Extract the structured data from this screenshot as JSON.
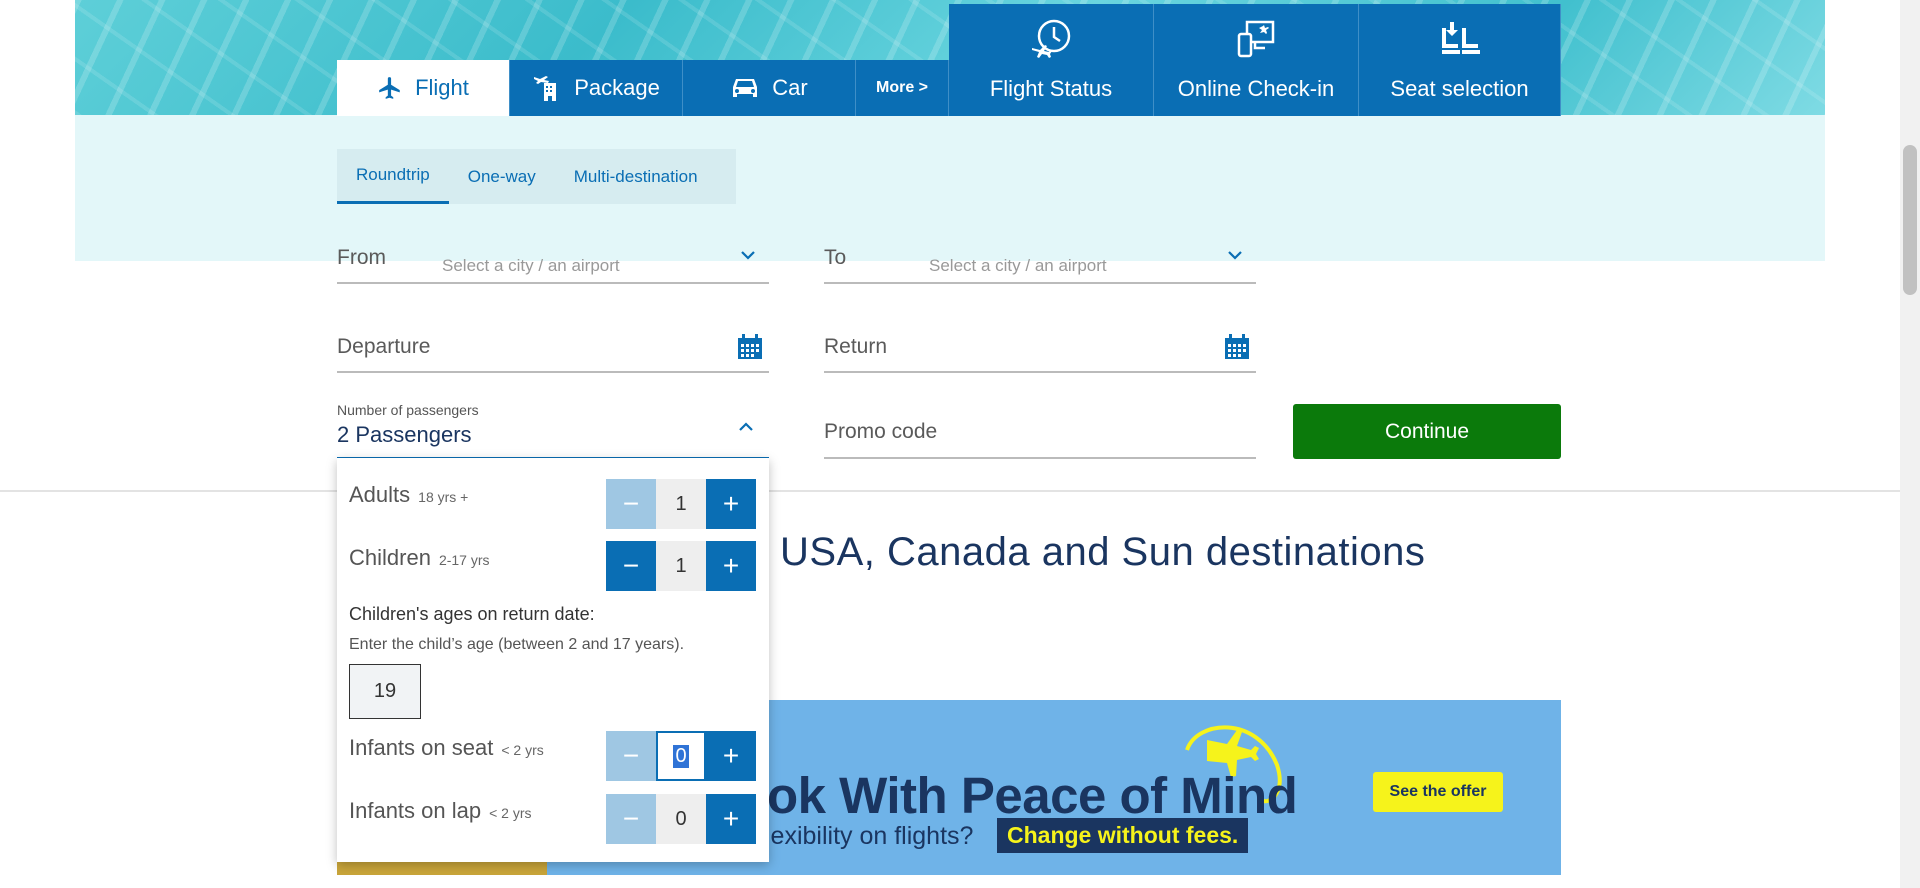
{
  "tabs": [
    {
      "label": "Flight",
      "icon": "plane-icon",
      "active": true
    },
    {
      "label": "Package",
      "icon": "hotel-plane-icon"
    },
    {
      "label": "Car",
      "icon": "car-icon"
    },
    {
      "label": "More >"
    }
  ],
  "tools": [
    {
      "label": "Flight Status",
      "icon": "clock-plane-icon"
    },
    {
      "label": "Online Check-in",
      "icon": "screen-phone-icon"
    },
    {
      "label": "Seat selection",
      "icon": "seats-icon"
    }
  ],
  "trip_types": [
    "Roundtrip",
    "One-way",
    "Multi-destination"
  ],
  "from": {
    "label": "From",
    "placeholder": "Select a city / an airport"
  },
  "to": {
    "label": "To",
    "placeholder": "Select a city / an airport"
  },
  "departure": {
    "label": "Departure"
  },
  "return": {
    "label": "Return"
  },
  "passengers": {
    "label": "Number of passengers",
    "value": "2 Passengers"
  },
  "promo": {
    "label": "Promo code"
  },
  "continue_label": "Continue",
  "pax": {
    "adults": {
      "label": "Adults",
      "range": "18 yrs +",
      "value": "1"
    },
    "children": {
      "label": "Children",
      "range": "2-17 yrs",
      "value": "1"
    },
    "ages_title": "Children's ages on return date:",
    "ages_hint": "Enter the child’s age (between 2 and 17 years).",
    "child_age": "19",
    "infants_seat": {
      "label": "Infants on seat",
      "range": "< 2 yrs",
      "value": "0"
    },
    "infants_lap": {
      "label": "Infants on lap",
      "range": "< 2 yrs",
      "value": "0"
    }
  },
  "promo_heading": "USA, Canada and Sun destinations",
  "banner": {
    "title": "ok With Peace of Mind",
    "subtitle": "lexibility on flights?",
    "tag": "Change without fees.",
    "offer": "See the offer"
  },
  "colors": {
    "brand": "#0a6eb4",
    "continue": "#0b7a0b",
    "navy": "#1a3560",
    "yellow": "#f6f31b"
  }
}
